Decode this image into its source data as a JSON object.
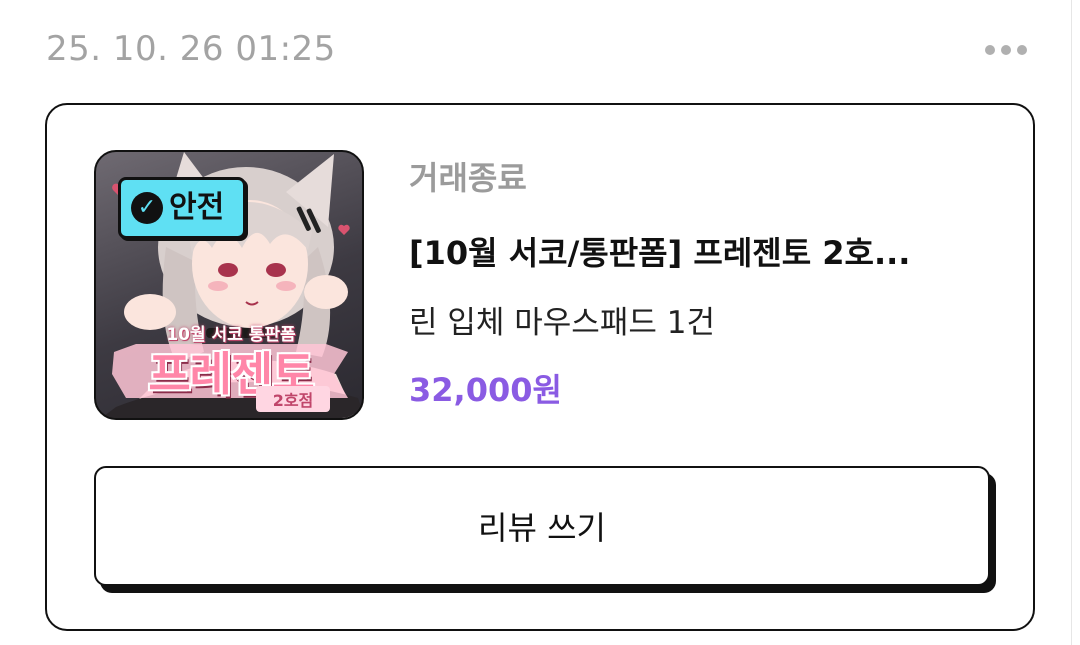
{
  "header": {
    "timestamp": "25. 10. 26 01:25",
    "more_icon": "more-horizontal-icon"
  },
  "order": {
    "thumbnail": {
      "badge_icon": "check-circle-icon",
      "badge_label": "안전",
      "image_subtitle": "10월 서코 통판폼",
      "image_title": "프레젠토",
      "image_tag": "2호점"
    },
    "status": "거래종료",
    "title": "[10월 서코/통판폼] 프레젠토 2호...",
    "option": "린 입체 마우스패드 1건",
    "price": "32,000원",
    "review_button_label": "리뷰 쓰기"
  },
  "colors": {
    "accent_price": "#8a5be3",
    "badge": "#5fe0f3",
    "muted_text": "#9b9b9b"
  }
}
